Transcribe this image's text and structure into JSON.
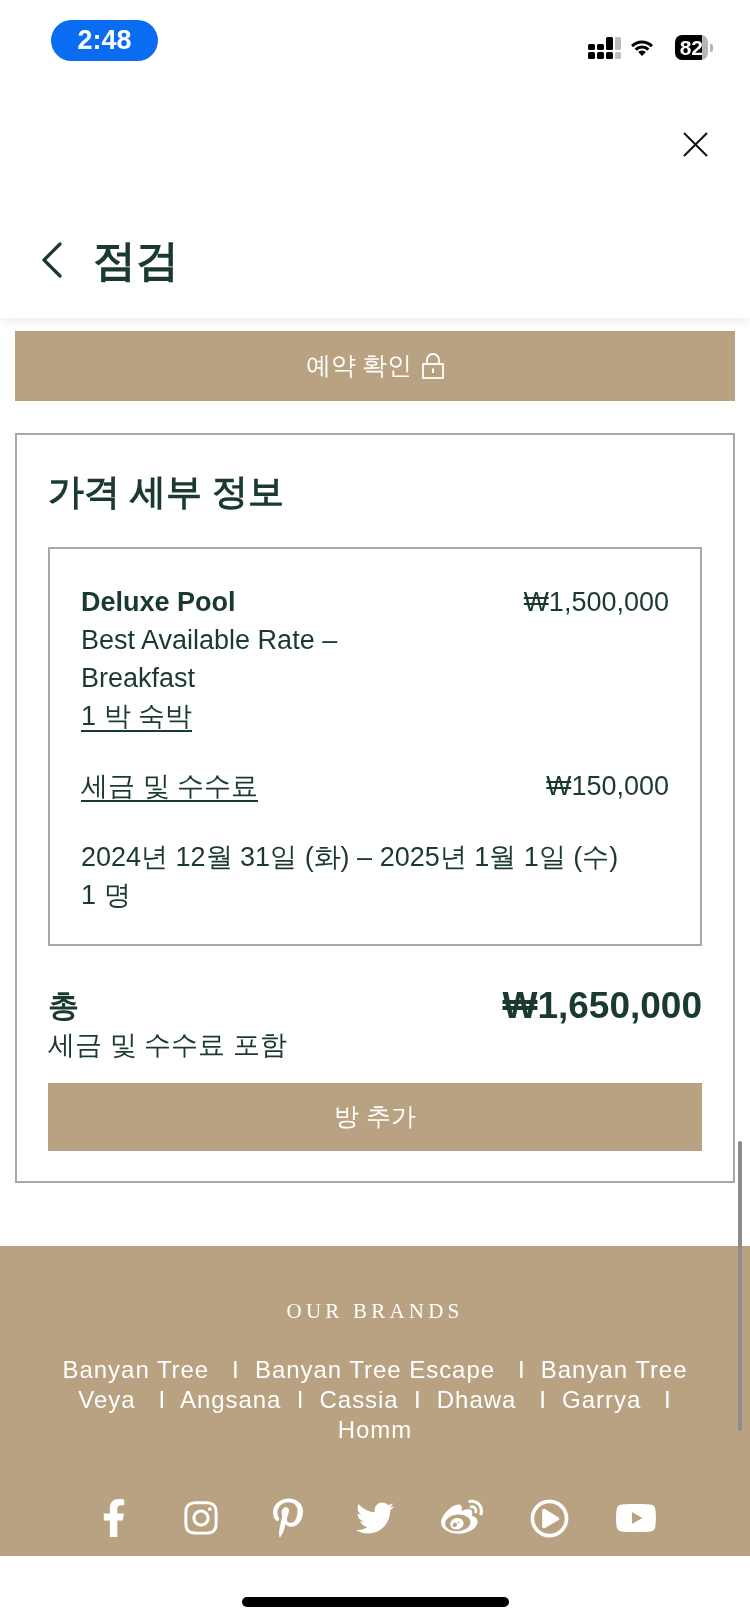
{
  "status_bar": {
    "time": "2:48",
    "battery": "82"
  },
  "header": {
    "title": "점검"
  },
  "confirm_button": {
    "label": "예약 확인"
  },
  "price_details": {
    "title": "가격 세부 정보",
    "room": {
      "name": "Deluxe Pool",
      "rate": "Best Available Rate – Breakfast",
      "stay": "1 박 숙박",
      "price": "₩1,500,000"
    },
    "taxes": {
      "label": "세금 및 수수료",
      "amount": "₩150,000"
    },
    "dates": "2024년 12월 31일 (화) – 2025년 1월 1일 (수)",
    "guests": "1 명",
    "total": {
      "label": "총",
      "amount": "₩1,650,000",
      "note": "세금 및 수수료 포함"
    },
    "add_room_button": {
      "label": "방 추가"
    }
  },
  "footer": {
    "heading": "OUR BRANDS",
    "brands": "Banyan Tree   I  Banyan Tree Escape   I  Banyan Tree Veya   I  Angsana  I  Cassia  I  Dhawa   I  Garrya   I  Homm"
  }
}
